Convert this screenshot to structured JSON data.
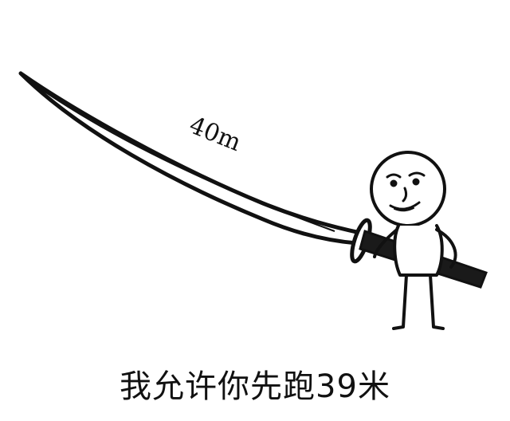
{
  "meme": {
    "sword_length_label": "40m",
    "caption": "我允许你先跑39米"
  }
}
